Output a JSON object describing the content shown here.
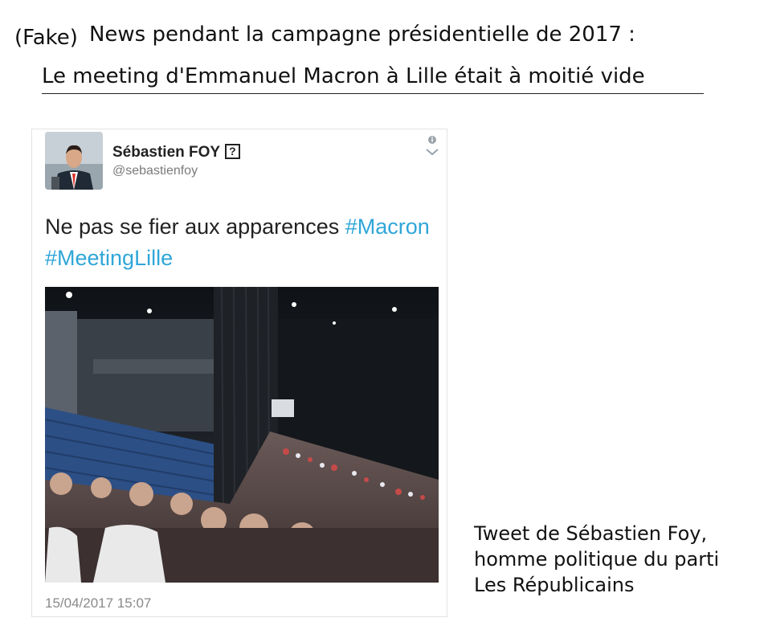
{
  "headline": {
    "fake_tag": "Fake",
    "text": "News pendant la campagne présidentielle de 2017 :"
  },
  "subheadline": "Le meeting d'Emmanuel Macron à Lille était à moitié vide",
  "tweet": {
    "author_name": "Sébastien FOY",
    "verified_glyph": "?",
    "handle": "@sebastienfoy",
    "text_plain": "Ne pas se fier aux apparences ",
    "hashtags": [
      "#Macron",
      "#MeetingLille"
    ],
    "timestamp": "15/04/2017 15:07",
    "icons": [
      "info-icon",
      "chevron-down-icon"
    ],
    "hashtag_color": "#2fa6d8"
  },
  "caption": {
    "lines": [
      "Tweet de Sébastien Foy,",
      "homme politique du parti",
      "Les Républicains"
    ]
  }
}
